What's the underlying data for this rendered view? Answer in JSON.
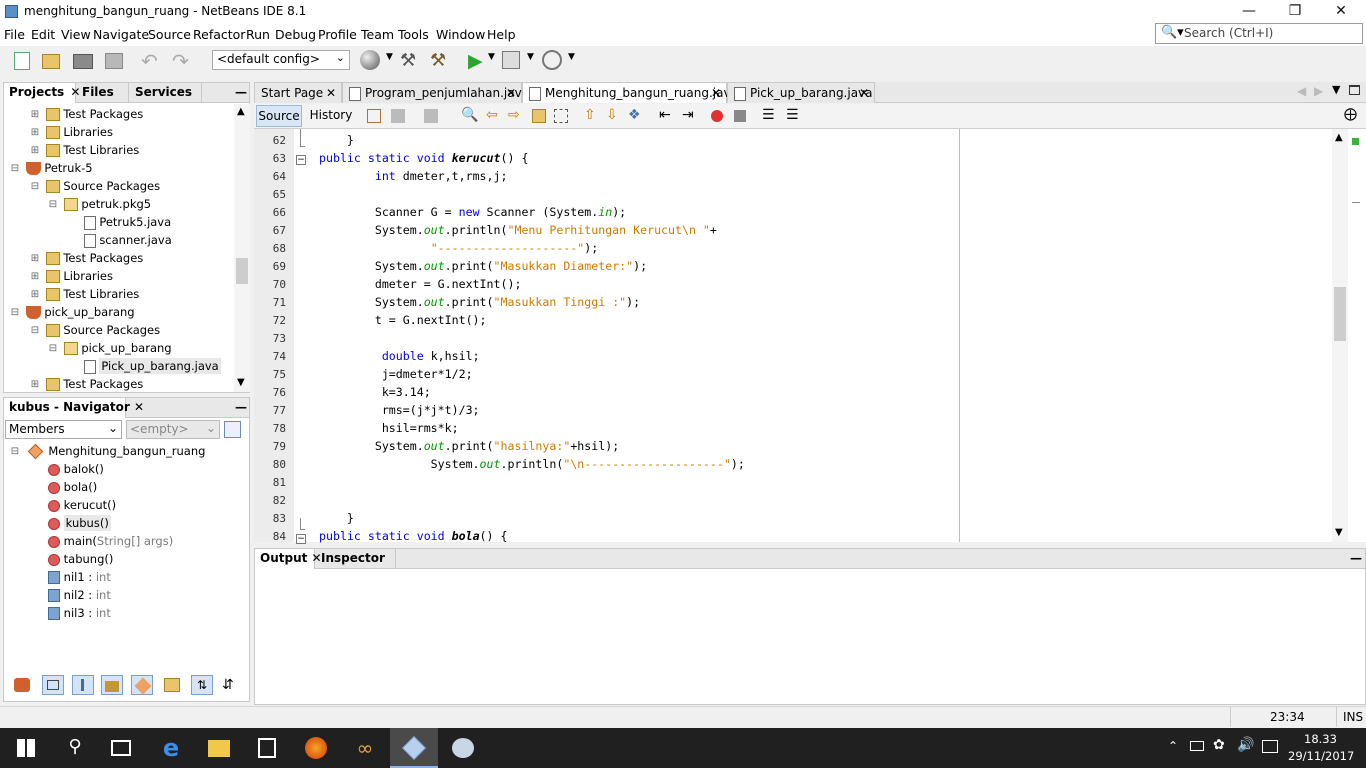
{
  "window": {
    "title": "menghitung_bangun_ruang - NetBeans IDE 8.1"
  },
  "menu": [
    "File",
    "Edit",
    "View",
    "Navigate",
    "Source",
    "Refactor",
    "Run",
    "Debug",
    "Profile",
    "Team",
    "Tools",
    "Window",
    "Help"
  ],
  "search": {
    "placeholder": "Search (Ctrl+I)"
  },
  "toolbar": {
    "config": "<default config>"
  },
  "projects_panel": {
    "tabs": [
      "Projects",
      "Files",
      "Services"
    ],
    "tree": [
      {
        "label": "Test Packages",
        "icon": "package-folder-icon",
        "level": 2
      },
      {
        "label": "Libraries",
        "icon": "library-folder-icon",
        "level": 2
      },
      {
        "label": "Test Libraries",
        "icon": "library-folder-icon",
        "level": 2
      },
      {
        "label": "Petruk-5",
        "icon": "project-coffee-icon",
        "level": 1
      },
      {
        "label": "Source Packages",
        "icon": "package-folder-icon",
        "level": 2
      },
      {
        "label": "petruk.pkg5",
        "icon": "package-icon",
        "level": 3
      },
      {
        "label": "Petruk5.java",
        "icon": "java-file-icon",
        "level": 4
      },
      {
        "label": "scanner.java",
        "icon": "java-file-icon",
        "level": 4
      },
      {
        "label": "Test Packages",
        "icon": "package-folder-icon",
        "level": 2
      },
      {
        "label": "Libraries",
        "icon": "library-folder-icon",
        "level": 2
      },
      {
        "label": "Test Libraries",
        "icon": "library-folder-icon",
        "level": 2
      },
      {
        "label": "pick_up_barang",
        "icon": "project-coffee-icon",
        "level": 1
      },
      {
        "label": "Source Packages",
        "icon": "package-folder-icon",
        "level": 2
      },
      {
        "label": "pick_up_barang",
        "icon": "package-icon",
        "level": 3
      },
      {
        "label": "Pick_up_barang.java",
        "icon": "java-file-icon",
        "level": 4,
        "selected": true
      },
      {
        "label": "Test Packages",
        "icon": "package-folder-icon",
        "level": 2
      }
    ]
  },
  "navigator": {
    "title": "kubus - Navigator",
    "filter": "Members",
    "empty": "<empty>",
    "root": "Menghitung_bangun_ruang",
    "members": [
      {
        "name": "balok()",
        "type": "",
        "kind": "method"
      },
      {
        "name": "bola()",
        "type": "",
        "kind": "method"
      },
      {
        "name": "kerucut()",
        "type": "",
        "kind": "method"
      },
      {
        "name": "kubus()",
        "type": "",
        "kind": "method",
        "selected": true
      },
      {
        "name": "main(",
        "type": "String[] args)",
        "kind": "method"
      },
      {
        "name": "tabung()",
        "type": "",
        "kind": "method"
      },
      {
        "name": "nil1 : ",
        "type": "int",
        "kind": "field"
      },
      {
        "name": "nil2 : ",
        "type": "int",
        "kind": "field"
      },
      {
        "name": "nil3 : ",
        "type": "int",
        "kind": "field"
      }
    ]
  },
  "editor": {
    "tabs": [
      {
        "label": "Start Page",
        "closable": true
      },
      {
        "label": "Program_penjumlahan.java",
        "closable": true
      },
      {
        "label": "Menghitung_bangun_ruang.java",
        "closable": true,
        "active": true
      },
      {
        "label": "Pick_up_barang.java",
        "closable": true
      }
    ],
    "subtabs": [
      "Source",
      "History"
    ],
    "lines": [
      {
        "n": "62",
        "parts": [
          {
            "t": "    }",
            "c": ""
          }
        ]
      },
      {
        "n": "63",
        "parts": [
          {
            "t": "public static void ",
            "c": "kw"
          },
          {
            "t": "kerucut",
            "c": "bi"
          },
          {
            "t": "() {",
            "c": ""
          }
        ]
      },
      {
        "n": "64",
        "parts": [
          {
            "t": "        ",
            "c": ""
          },
          {
            "t": "int",
            "c": "kw"
          },
          {
            "t": " dmeter,t,rms,j;",
            "c": ""
          }
        ]
      },
      {
        "n": "65",
        "parts": [
          {
            "t": "",
            "c": ""
          }
        ]
      },
      {
        "n": "66",
        "parts": [
          {
            "t": "        Scanner G = ",
            "c": ""
          },
          {
            "t": "new",
            "c": "kw"
          },
          {
            "t": " Scanner (System.",
            "c": ""
          },
          {
            "t": "in",
            "c": "fi"
          },
          {
            "t": ");",
            "c": ""
          }
        ]
      },
      {
        "n": "67",
        "parts": [
          {
            "t": "        System.",
            "c": ""
          },
          {
            "t": "out",
            "c": "fi"
          },
          {
            "t": ".println(",
            "c": ""
          },
          {
            "t": "\"Menu Perhitungan Kerucut\\n \"",
            "c": "st"
          },
          {
            "t": "+",
            "c": ""
          }
        ]
      },
      {
        "n": "68",
        "parts": [
          {
            "t": "                ",
            "c": ""
          },
          {
            "t": "\"--------------------\"",
            "c": "st"
          },
          {
            "t": ");",
            "c": ""
          }
        ]
      },
      {
        "n": "69",
        "parts": [
          {
            "t": "        System.",
            "c": ""
          },
          {
            "t": "out",
            "c": "fi"
          },
          {
            "t": ".print(",
            "c": ""
          },
          {
            "t": "\"Masukkan Diameter:\"",
            "c": "st"
          },
          {
            "t": ");",
            "c": ""
          }
        ]
      },
      {
        "n": "70",
        "parts": [
          {
            "t": "        dmeter = G.nextInt();",
            "c": ""
          }
        ]
      },
      {
        "n": "71",
        "parts": [
          {
            "t": "        System.",
            "c": ""
          },
          {
            "t": "out",
            "c": "fi"
          },
          {
            "t": ".print(",
            "c": ""
          },
          {
            "t": "\"Masukkan Tinggi :\"",
            "c": "st"
          },
          {
            "t": ");",
            "c": ""
          }
        ]
      },
      {
        "n": "72",
        "parts": [
          {
            "t": "        t = G.nextInt();",
            "c": ""
          }
        ]
      },
      {
        "n": "73",
        "parts": [
          {
            "t": "",
            "c": ""
          }
        ]
      },
      {
        "n": "74",
        "parts": [
          {
            "t": "         ",
            "c": ""
          },
          {
            "t": "double",
            "c": "kw"
          },
          {
            "t": " k,hsil;",
            "c": ""
          }
        ]
      },
      {
        "n": "75",
        "parts": [
          {
            "t": "         j=dmeter*1/2;",
            "c": ""
          }
        ]
      },
      {
        "n": "76",
        "parts": [
          {
            "t": "         k=3.14;",
            "c": ""
          }
        ]
      },
      {
        "n": "77",
        "parts": [
          {
            "t": "         rms=(j*j*t)/3;",
            "c": ""
          }
        ]
      },
      {
        "n": "78",
        "parts": [
          {
            "t": "         hsil=rms*k;",
            "c": ""
          }
        ]
      },
      {
        "n": "79",
        "parts": [
          {
            "t": "        System.",
            "c": ""
          },
          {
            "t": "out",
            "c": "fi"
          },
          {
            "t": ".print(",
            "c": ""
          },
          {
            "t": "\"hasilnya:\"",
            "c": "st"
          },
          {
            "t": "+hsil);",
            "c": ""
          }
        ]
      },
      {
        "n": "80",
        "parts": [
          {
            "t": "                System.",
            "c": ""
          },
          {
            "t": "out",
            "c": "fi"
          },
          {
            "t": ".println(",
            "c": ""
          },
          {
            "t": "\"\\n--------------------\"",
            "c": "st"
          },
          {
            "t": ");",
            "c": ""
          }
        ]
      },
      {
        "n": "81",
        "parts": [
          {
            "t": "",
            "c": ""
          }
        ]
      },
      {
        "n": "82",
        "parts": [
          {
            "t": "",
            "c": ""
          }
        ]
      },
      {
        "n": "83",
        "parts": [
          {
            "t": "    }",
            "c": ""
          }
        ]
      },
      {
        "n": "84",
        "parts": [
          {
            "t": "public static void ",
            "c": "kw"
          },
          {
            "t": "bola",
            "c": "bi"
          },
          {
            "t": "() {",
            "c": ""
          }
        ]
      }
    ]
  },
  "output_panel": {
    "tabs": [
      "Output",
      "Inspector"
    ]
  },
  "status": {
    "position": "23:34",
    "mode": "INS"
  },
  "taskbar": {
    "time": "18.33",
    "date": "29/11/2017"
  }
}
